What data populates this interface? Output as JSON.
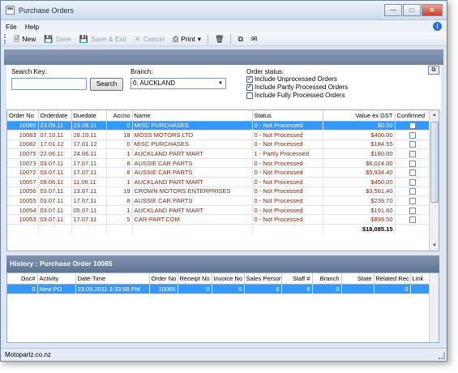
{
  "window": {
    "title": "Purchase Orders"
  },
  "menu": {
    "items": [
      "File",
      "Help"
    ]
  },
  "toolbar": {
    "new": "New",
    "save": "Save",
    "save_exit": "Save & Exit",
    "cancel": "Cancel",
    "print": "Print"
  },
  "search": {
    "label": "Search Key:",
    "value": "",
    "button": "Search"
  },
  "branch": {
    "label": "Branch:",
    "value": "0. AUCKLAND"
  },
  "order_status": {
    "label": "Order status:",
    "options": [
      {
        "label": "Include Unprocessed Orders",
        "checked": true
      },
      {
        "label": "Include Partly Processed Orders",
        "checked": true
      },
      {
        "label": "Include Fully Processed Orders",
        "checked": false
      }
    ]
  },
  "orders": {
    "columns": [
      "Order No",
      "Orderdate",
      "Duedate",
      "Accno",
      "Name",
      "Status",
      "Value ex GST",
      "Confirmed"
    ],
    "rows": [
      {
        "order_no": "10085",
        "orderdate": "23.09.11",
        "duedate": "23.09.11",
        "accno": "0",
        "name": "MISC PURCHASES",
        "status": "0 - Not Processed",
        "value": "$0.00"
      },
      {
        "order_no": "10083",
        "orderdate": "07.10.11",
        "duedate": "28.10.11",
        "accno": "18",
        "name": "MOSS MOTORS LTD",
        "status": "0 - Not Processed",
        "value": "$400.00"
      },
      {
        "order_no": "10082",
        "orderdate": "17.01.12",
        "duedate": "17.01.12",
        "accno": "0",
        "name": "MISC PURCHASES",
        "status": "0 - Not Processed",
        "value": "$184.55"
      },
      {
        "order_no": "10075",
        "orderdate": "22.06.11",
        "duedate": "24.06.11",
        "accno": "1",
        "name": "AUCKLAND PART MART",
        "status": "1 - Partly Processed",
        "value": "$180.00"
      },
      {
        "order_no": "10073",
        "orderdate": "03.07.11",
        "duedate": "17.07.11",
        "accno": "8",
        "name": "AUSSIE CAR PARTS",
        "status": "0 - Not Processed",
        "value": "$6,024.00"
      },
      {
        "order_no": "10072",
        "orderdate": "03.07.11",
        "duedate": "17.07.11",
        "accno": "8",
        "name": "AUSSIE CAR PARTS",
        "status": "0 - Not Processed",
        "value": "$5,934.40"
      },
      {
        "order_no": "10057",
        "orderdate": "09.06.11",
        "duedate": "11.06.11",
        "accno": "1",
        "name": "AUCKLAND PART MART",
        "status": "0 - Not Processed",
        "value": "$450.00"
      },
      {
        "order_no": "10056",
        "orderdate": "03.07.11",
        "duedate": "13.07.11",
        "accno": "19",
        "name": "CROWN MOTORS ENTERPRISES",
        "status": "0 - Not Processed",
        "value": "$3,581.40"
      },
      {
        "order_no": "10055",
        "orderdate": "03.07.11",
        "duedate": "17.07.11",
        "accno": "8",
        "name": "AUSSIE CAR PARTS",
        "status": "0 - Not Processed",
        "value": "$239.70"
      },
      {
        "order_no": "10054",
        "orderdate": "03.07.11",
        "duedate": "05.07.11",
        "accno": "1",
        "name": "AUCKLAND PART MART",
        "status": "0 - Not Processed",
        "value": "$191.60"
      },
      {
        "order_no": "10053",
        "orderdate": "03.07.11",
        "duedate": "17.07.11",
        "accno": "5",
        "name": "CAR-PART.COM",
        "status": "0 - Not Processed",
        "value": "$899.50"
      }
    ],
    "total": "$18,085.15"
  },
  "history": {
    "title": "History : Purchase Order 10085",
    "columns": [
      "Doc#",
      "Activity",
      "Date-Time",
      "Order No",
      "Receipt No",
      "Invoice No",
      "Sales Person",
      "Staff #",
      "Branch",
      "State",
      "Related Rec",
      "Link"
    ],
    "rows": [
      {
        "doc": "0",
        "activity": "New PO",
        "datetime": "23.09.2011 3:33:58 PM",
        "order_no": "10085",
        "receipt_no": "0",
        "invoice_no": "0",
        "sales_person": "8",
        "staff": "8",
        "branch": "0",
        "state": "",
        "related": "0",
        "link": ""
      }
    ]
  },
  "status_bar": {
    "text": "Motopartz.co.nz"
  }
}
